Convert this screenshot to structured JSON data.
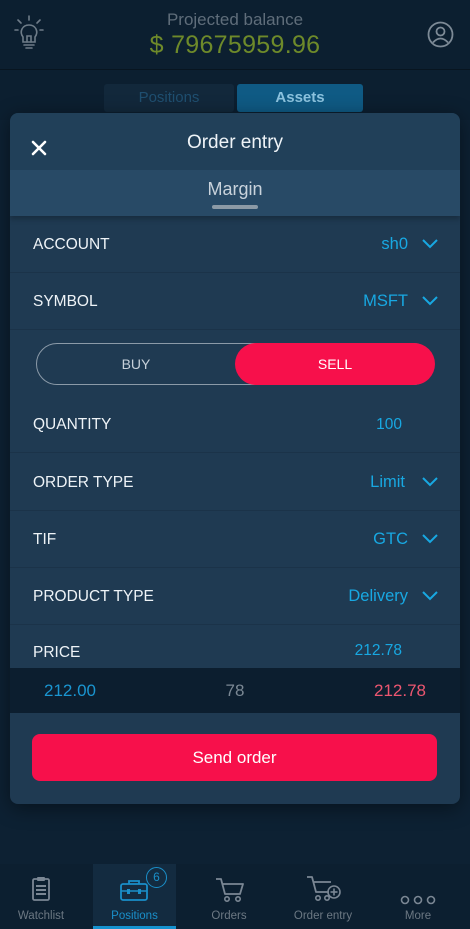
{
  "header": {
    "projected_label": "Projected balance",
    "projected_value": "$ 79675959.96"
  },
  "segments": {
    "positions": "Positions",
    "assets": "Assets",
    "active": "Assets"
  },
  "order_entry": {
    "title": "Order entry",
    "margin_label": "Margin",
    "account": {
      "label": "ACCOUNT",
      "value": "sh0"
    },
    "symbol": {
      "label": "SYMBOL",
      "value": "MSFT"
    },
    "side": {
      "buy": "BUY",
      "sell": "SELL",
      "selected": "SELL"
    },
    "quantity": {
      "label": "QUANTITY",
      "value": "100"
    },
    "order_type": {
      "label": "ORDER TYPE",
      "value": "Limit"
    },
    "tif": {
      "label": "TIF",
      "value": "GTC"
    },
    "product_type": {
      "label": "PRODUCT TYPE",
      "value": "Delivery"
    },
    "price": {
      "label": "PRICE",
      "value": "212.78"
    },
    "ladder": {
      "bid": "212.00",
      "mid": "78",
      "ask": "212.78"
    },
    "send_label": "Send order"
  },
  "nav": {
    "active": "Positions",
    "items": [
      {
        "label": "Watchlist",
        "icon": "clipboard-icon"
      },
      {
        "label": "Positions",
        "icon": "briefcase-icon",
        "badge": "6"
      },
      {
        "label": "Orders",
        "icon": "cart-icon"
      },
      {
        "label": "Order entry",
        "icon": "cart-plus-icon"
      },
      {
        "label": "More",
        "icon": "more-dots-icon"
      }
    ]
  },
  "colors": {
    "accent": "#18a8e2",
    "sell": "#f7104b",
    "balance": "#6e8a2a",
    "ask": "#ec5670"
  }
}
